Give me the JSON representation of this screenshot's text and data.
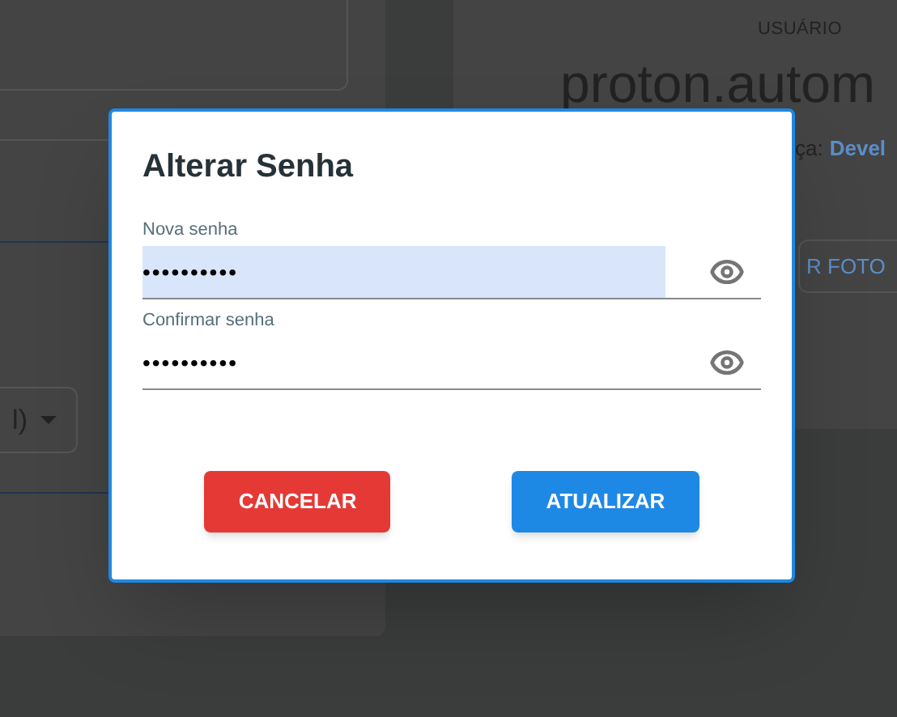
{
  "background": {
    "left_card": {
      "select_value": "l)"
    },
    "right_card": {
      "section_label": "USUÁRIO",
      "username": "proton.autom",
      "detail_label": "ça:",
      "detail_value": "Devel",
      "button": "R FOTO"
    }
  },
  "dialog": {
    "title": "Alterar Senha",
    "fields": [
      {
        "label": "Nova senha",
        "value": "••••••••••",
        "autofilled": true
      },
      {
        "label": "Confirmar senha",
        "value": "••••••••••",
        "autofilled": false
      }
    ],
    "buttons": [
      {
        "label": "CANCELAR",
        "kind": "cancel"
      },
      {
        "label": "ATUALIZAR",
        "kind": "confirm"
      }
    ]
  }
}
